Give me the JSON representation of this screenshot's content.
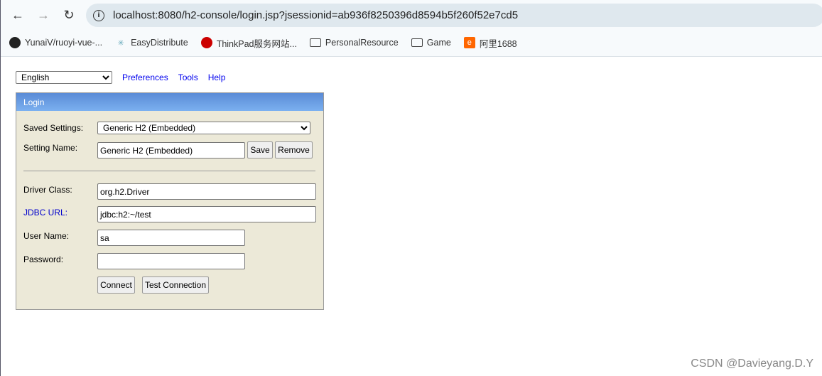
{
  "browser": {
    "url": "localhost:8080/h2-console/login.jsp?jsessionid=ab936f8250396d8594b5f260f52e7cd5",
    "bookmarks": [
      {
        "label": "YunaiV/ruoyi-vue-...",
        "icon": "github-icon"
      },
      {
        "label": "EasyDistribute",
        "icon": "app-icon"
      },
      {
        "label": "ThinkPad服务网站...",
        "icon": "thinkpad-icon"
      },
      {
        "label": "PersonalResource",
        "icon": "folder-icon"
      },
      {
        "label": "Game",
        "icon": "folder-icon"
      },
      {
        "label": "阿里1688",
        "icon": "alibaba-icon"
      }
    ]
  },
  "top": {
    "language": "English",
    "links": [
      "Preferences",
      "Tools",
      "Help"
    ]
  },
  "login": {
    "title": "Login",
    "saved_settings_label": "Saved Settings:",
    "saved_settings_value": "Generic H2 (Embedded)",
    "setting_name_label": "Setting Name:",
    "setting_name_value": "Generic H2 (Embedded)",
    "save": "Save",
    "remove": "Remove",
    "driver_label": "Driver Class:",
    "driver_value": "org.h2.Driver",
    "jdbc_label": "JDBC URL:",
    "jdbc_value": "jdbc:h2:~/test",
    "user_label": "User Name:",
    "user_value": "sa",
    "password_label": "Password:",
    "password_value": "",
    "connect": "Connect",
    "test": "Test Connection"
  },
  "watermark": "CSDN @Davieyang.D.Y"
}
